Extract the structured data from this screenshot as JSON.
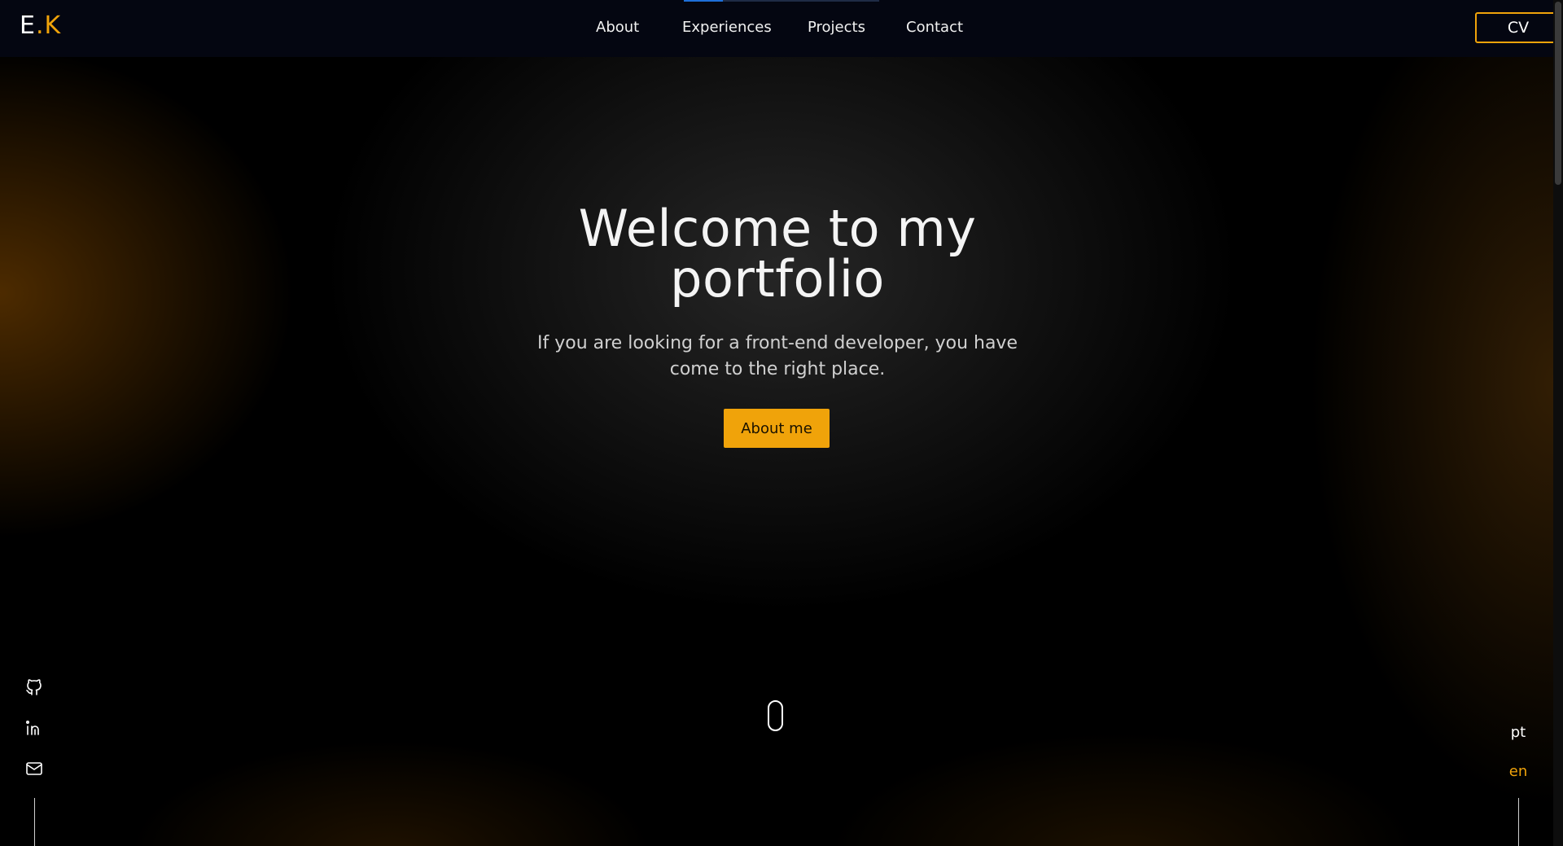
{
  "header": {
    "logo_left": "E",
    "logo_right": ".K",
    "nav": [
      {
        "label": "About"
      },
      {
        "label": "Experiences"
      },
      {
        "label": "Projects"
      },
      {
        "label": "Contact"
      }
    ],
    "cv_label": "CV"
  },
  "hero": {
    "title": "Welcome to my portfolio",
    "subtitle": "If you are looking for a front-end developer, you have come to the right place.",
    "cta_label": "About me"
  },
  "social": [
    {
      "icon": "github-icon"
    },
    {
      "icon": "linkedin-icon"
    },
    {
      "icon": "mail-icon"
    }
  ],
  "languages": {
    "options": [
      "pt",
      "en"
    ],
    "selected": "en"
  },
  "colors": {
    "accent": "#f0a30a",
    "navbar_bg": "#040611",
    "background": "#000000",
    "nav_active_indicator": "#1e6fd9"
  }
}
